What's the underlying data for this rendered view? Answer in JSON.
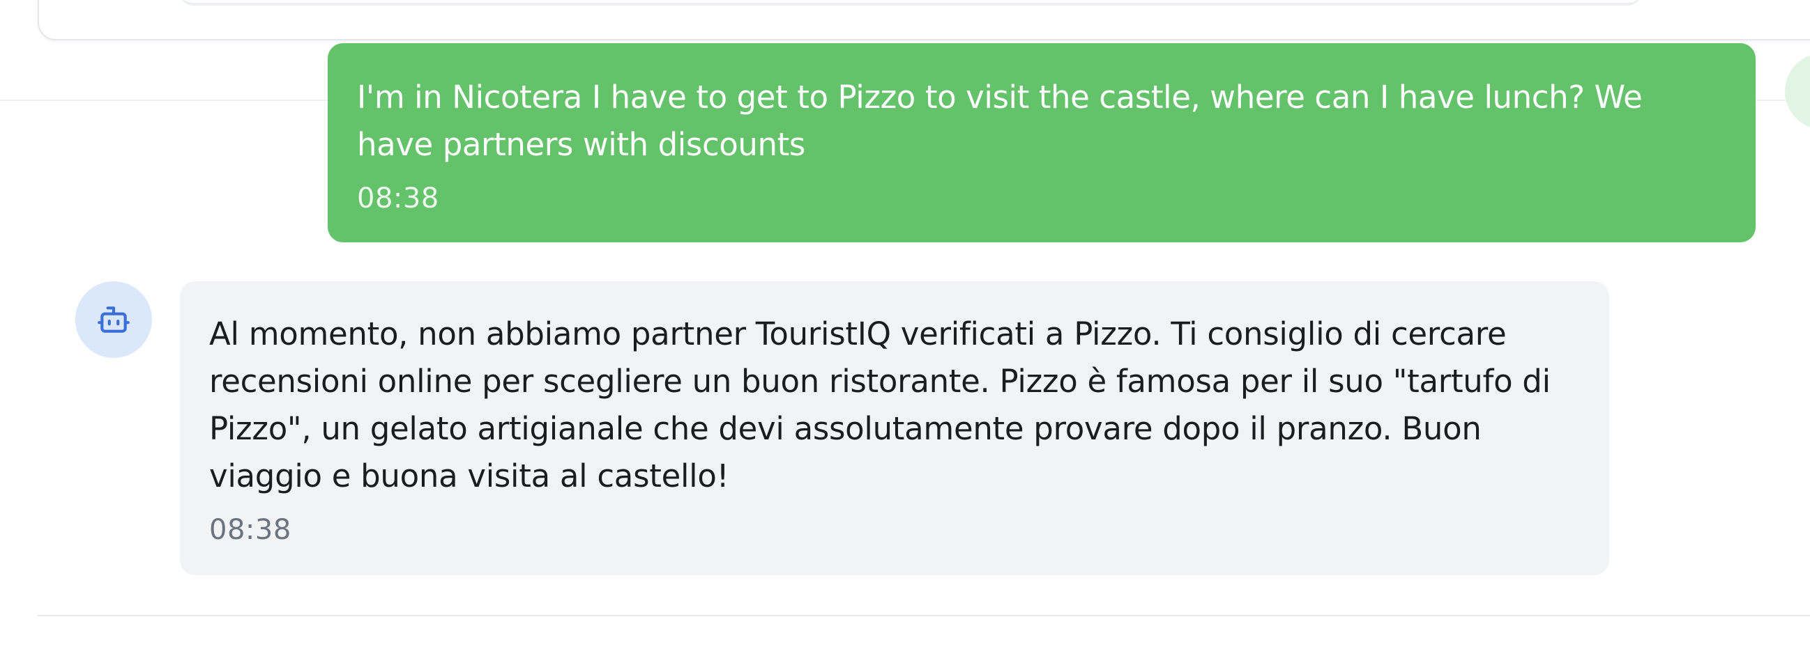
{
  "messages": [
    {
      "role": "user",
      "text": "I'm in Nicotera I have to get to Pizzo to visit the castle, where can I have lunch? We have partners with discounts",
      "time": "08:38"
    },
    {
      "role": "assistant",
      "text": "Al momento, non abbiamo partner TouristIQ verificati a Pizzo. Ti consiglio di cercare recensioni online per scegliere un buon ristorante. Pizzo è famosa per il suo \"tartufo di Pizzo\", un gelato artigianale che devi assolutamente provare dopo il pranzo. Buon viaggio e buona visita al castello!",
      "time": "08:38",
      "avatar_icon": "bot-icon"
    }
  ],
  "colors": {
    "user_bubble": "#63c26a",
    "bot_bubble": "#f2f3f5",
    "bot_avatar_bg": "#dbe7fb",
    "bot_icon": "#3b6fd8",
    "user_avatar_bg": "#e2f5e4"
  }
}
